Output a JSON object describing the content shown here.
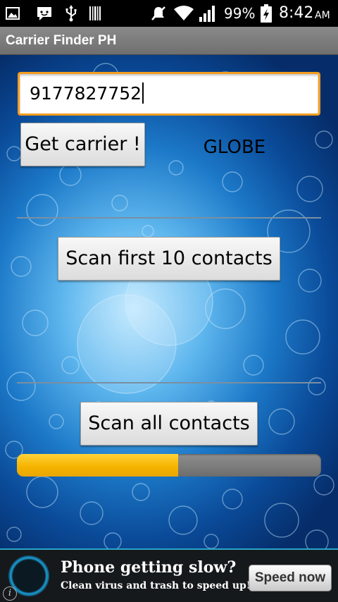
{
  "status_bar": {
    "battery_percent": "99%",
    "time": "8:42",
    "ampm": "AM",
    "icons": [
      "image-icon",
      "chat-icon",
      "usb-icon",
      "barcode-icon",
      "mute-icon",
      "wifi-icon",
      "signal-icon",
      "battery-charging-icon"
    ]
  },
  "app": {
    "title": "Carrier Finder PH"
  },
  "main": {
    "phone_input_value": "9177827752",
    "get_carrier_label": "Get carrier !",
    "carrier_result": "GLOBE",
    "scan_first_label": "Scan first 10 contacts",
    "scan_all_label": "Scan all contacts",
    "scan_progress_fraction": 0.53
  },
  "ad": {
    "headline": "Phone getting slow?",
    "subtext": "Clean virus and trash to speed up!",
    "cta_label": "Speed now",
    "info_glyph": "i"
  },
  "colors": {
    "accent_orange": "#f39c1e",
    "progress_yellow": "#f6b400",
    "title_bar": "#7a7a7a",
    "ad_border": "#2aa6c8"
  }
}
